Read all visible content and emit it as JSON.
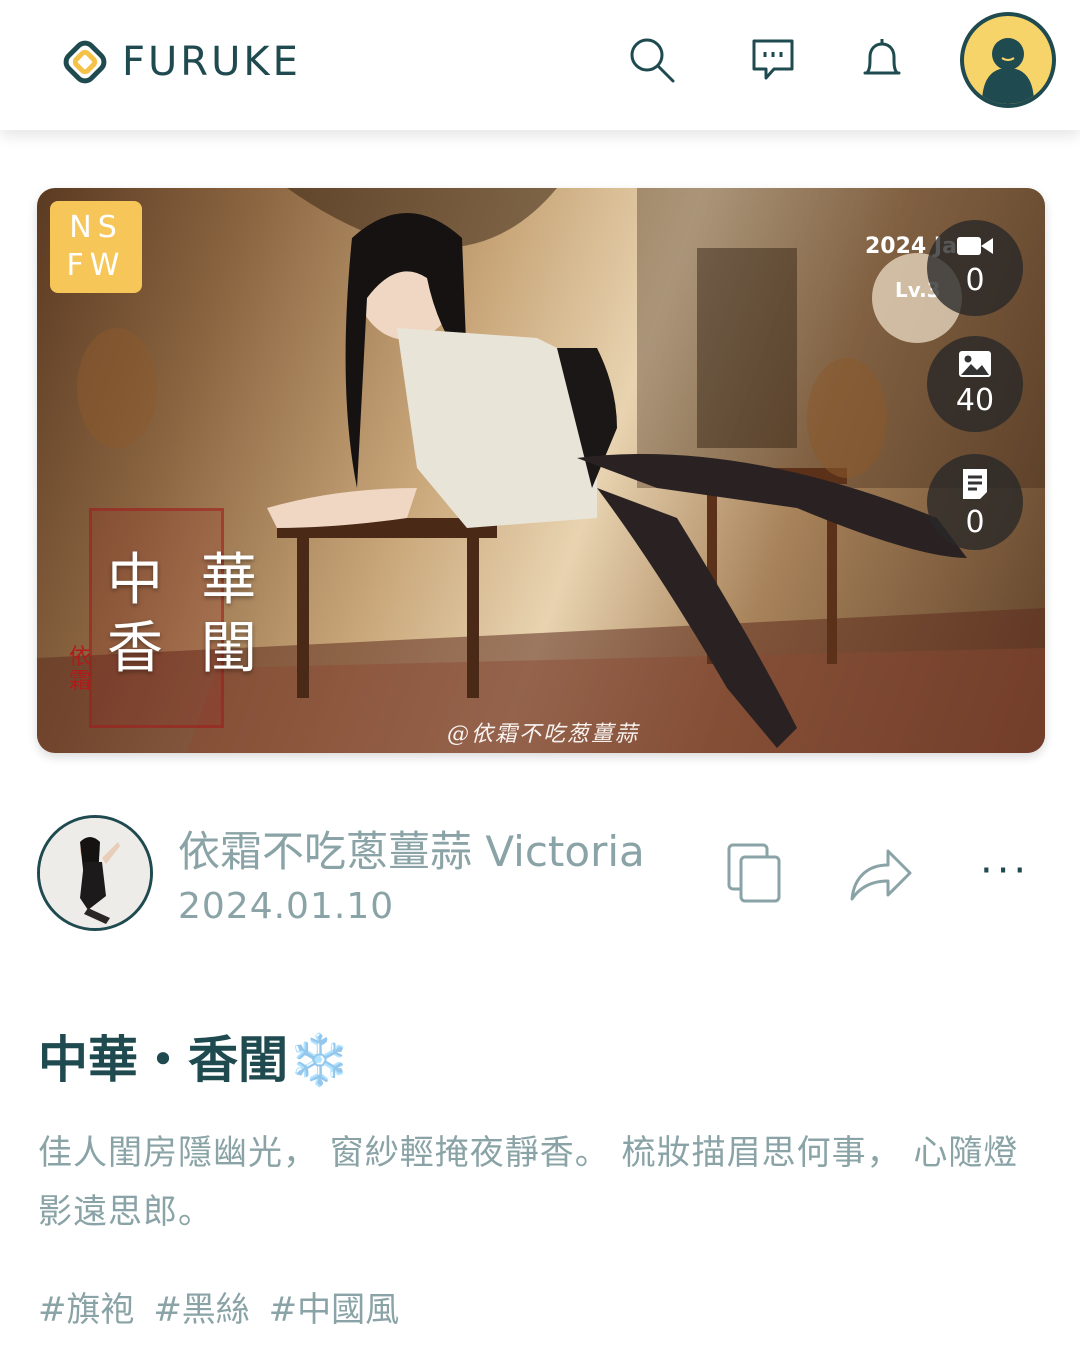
{
  "header": {
    "logo_text": "FURUKE",
    "icons": [
      "search-icon",
      "message-icon",
      "bell-icon",
      "user-avatar-icon"
    ]
  },
  "hero": {
    "nsfw_badge": "NS FW",
    "image_title_line1": "中 華",
    "image_title_line2": "香 閨",
    "image_signature": "依霜",
    "image_watermark": "@依霜不吃葱薑蒜",
    "image_corner_year": "2024 Jan",
    "image_corner_lv": "Lv.3",
    "stats": [
      {
        "icon": "video-icon",
        "value": "0"
      },
      {
        "icon": "image-icon",
        "value": "40"
      },
      {
        "icon": "document-icon",
        "value": "0"
      }
    ]
  },
  "author": {
    "name": "依霜不吃蔥薑蒜 Victoria",
    "date": "2024.01.10"
  },
  "actions": [
    "copy-icon",
    "share-icon",
    "more-icon"
  ],
  "more_label": "···",
  "post": {
    "title": "中華・香閨",
    "title_emoji": "❄️",
    "description": "佳人閨房隱幽光， 窗紗輕掩夜靜香。 梳妝描眉思何事， 心隨燈影遠思郎。",
    "tags": [
      "#旗袍",
      "#黑絲",
      "#中國風"
    ]
  },
  "colors": {
    "brand": "#1f4a4f",
    "muted_text": "#8aa3a6",
    "nsfw_badge": "#f7c659",
    "avatar_bg": "#f7d46a"
  }
}
